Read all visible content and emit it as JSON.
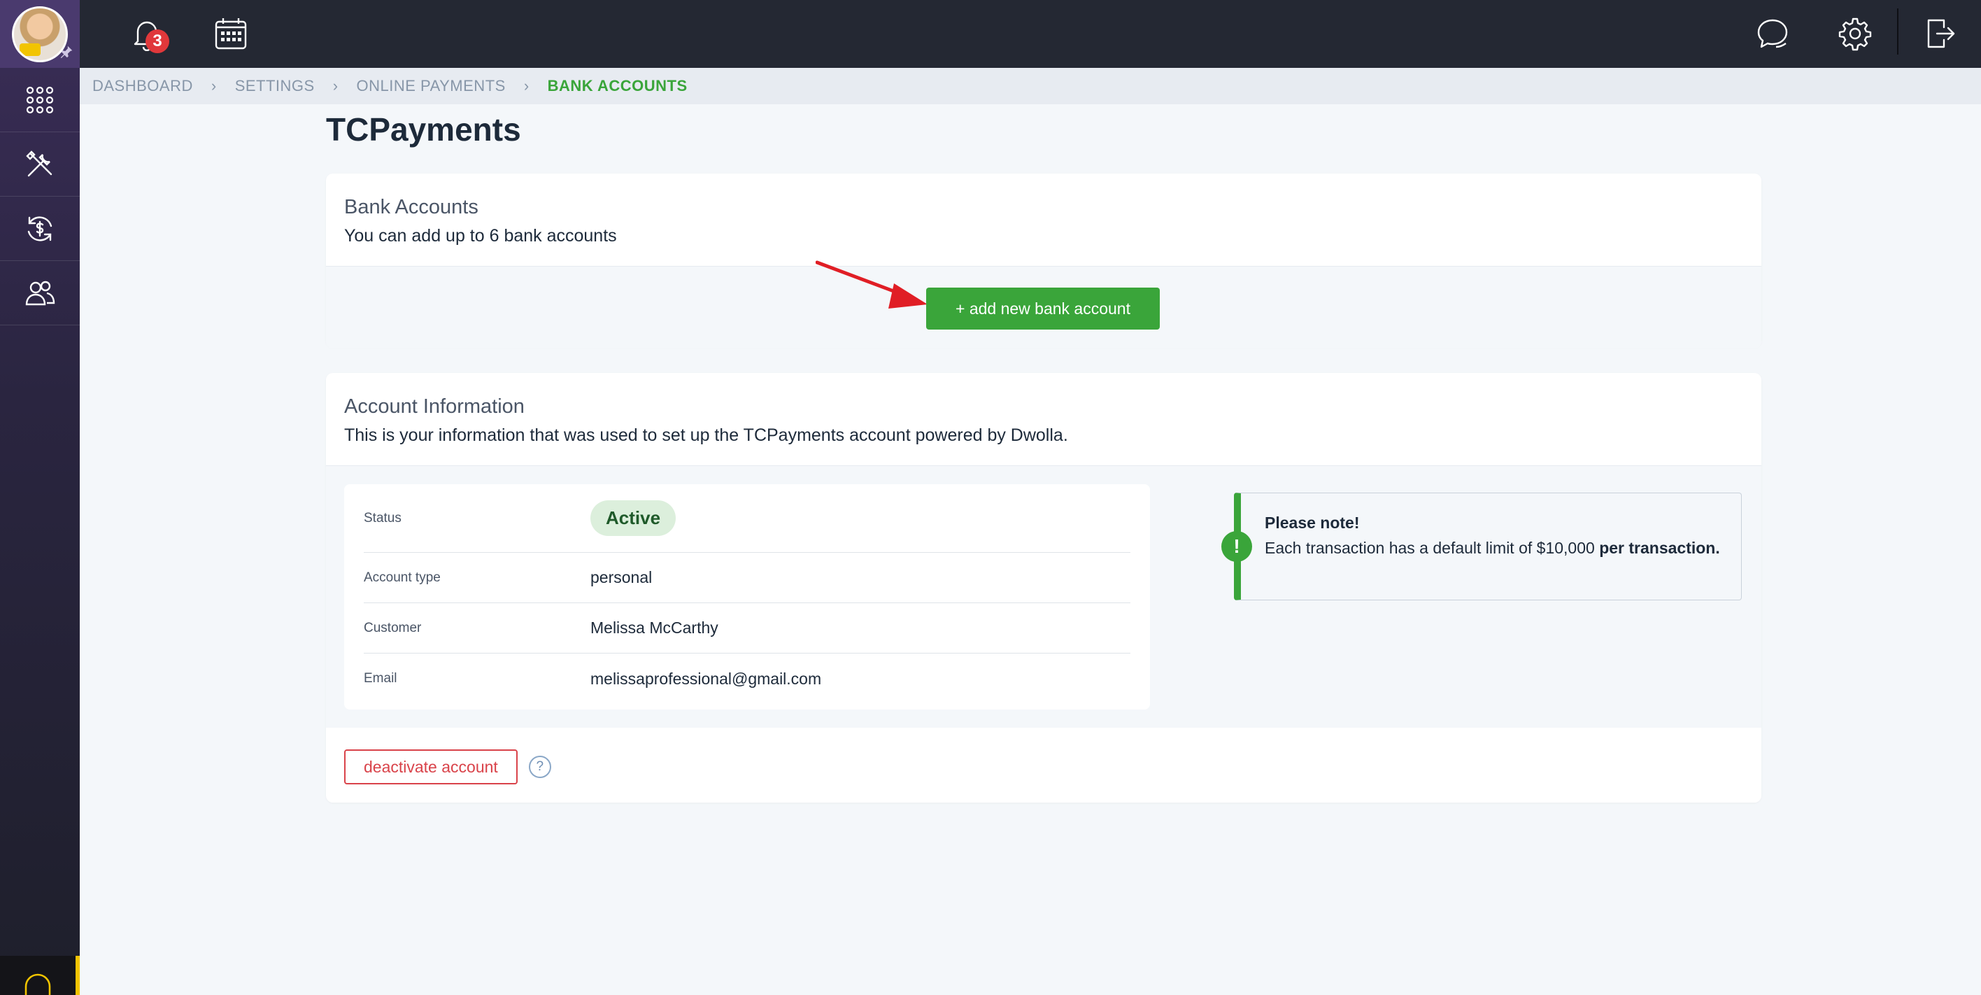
{
  "topbar": {
    "notifications_count": "3"
  },
  "breadcrumb": {
    "items": [
      "DASHBOARD",
      "SETTINGS",
      "ONLINE PAYMENTS",
      "BANK ACCOUNTS"
    ],
    "separator": "›"
  },
  "page": {
    "title": "TCPayments"
  },
  "bank_accounts": {
    "title": "Bank Accounts",
    "subtitle": "You can add up to 6 bank accounts",
    "add_button": "+ add new bank account"
  },
  "account_info": {
    "title": "Account Information",
    "subtitle": "This is your information that was used to set up the TCPayments account powered by Dwolla.",
    "rows": [
      {
        "label": "Status",
        "value": "Active"
      },
      {
        "label": "Account type",
        "value": "personal"
      },
      {
        "label": "Customer",
        "value": "Melissa McCarthy"
      },
      {
        "label": "Email",
        "value": "melissaprofessional@gmail.com"
      }
    ],
    "note": {
      "icon": "!",
      "title": "Please note!",
      "text": "Each transaction has a default limit of $10,000",
      "bold_text": "per transaction."
    },
    "deactivate_button": "deactivate account",
    "help": "?"
  },
  "colors": {
    "accent": "#3aa53a",
    "danger": "#d9434a",
    "topbar": "#242833"
  }
}
